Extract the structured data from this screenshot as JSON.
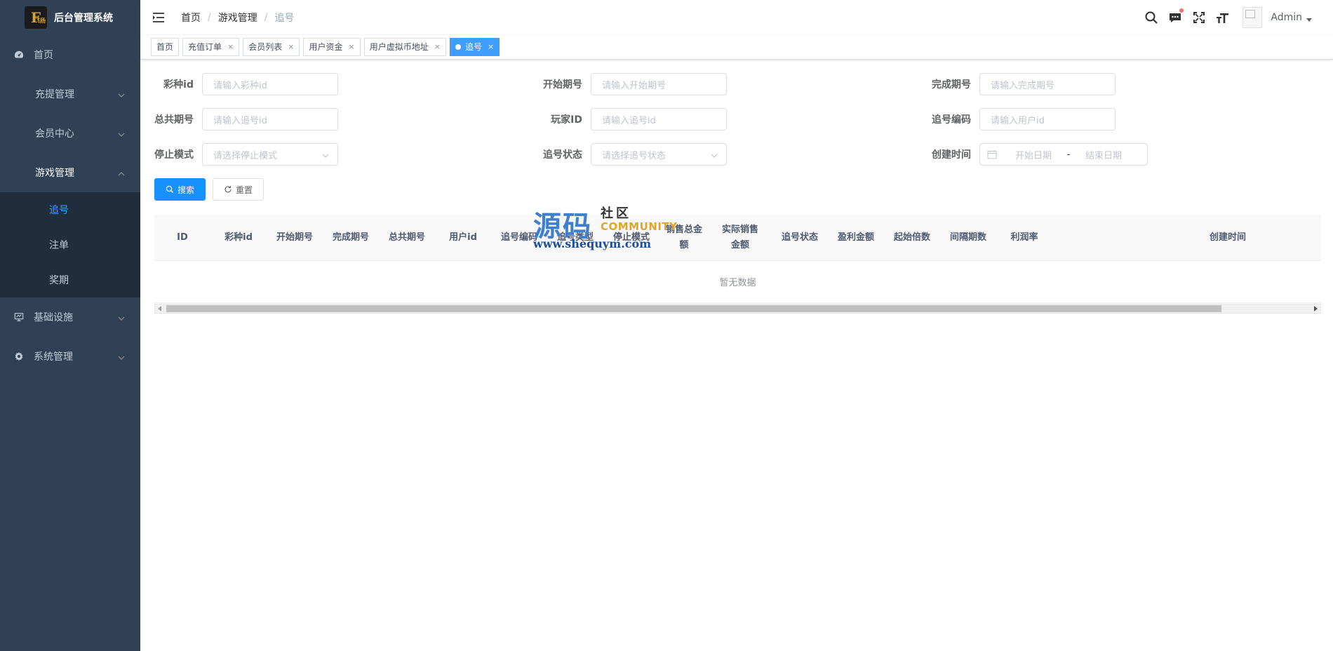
{
  "app": {
    "logo_mark": "F",
    "logo_sub": "飞扬",
    "title": "后台管理系统"
  },
  "sidebar": {
    "items": [
      {
        "label": "首页"
      },
      {
        "label": "充提管理"
      },
      {
        "label": "会员中心"
      },
      {
        "label": "游戏管理"
      },
      {
        "label": "基础设施"
      },
      {
        "label": "系统管理"
      }
    ],
    "game_sub": [
      {
        "label": "追号"
      },
      {
        "label": "注单"
      },
      {
        "label": "奖期"
      }
    ]
  },
  "breadcrumb": {
    "home": "首页",
    "sep": "/",
    "parent": "游戏管理",
    "current": "追号"
  },
  "navbar": {
    "username": "Admin"
  },
  "tags": [
    {
      "label": "首页"
    },
    {
      "label": "充值订单",
      "close": "×"
    },
    {
      "label": "会员列表",
      "close": "×"
    },
    {
      "label": "用户资金",
      "close": "×"
    },
    {
      "label": "用户虚拟币地址",
      "close": "×"
    },
    {
      "label": "追号",
      "close": "×"
    }
  ],
  "filters": {
    "lottery_id": {
      "label": "彩种id",
      "placeholder": "请输入彩种id"
    },
    "start_issue": {
      "label": "开始期号",
      "placeholder": "请输入开始期号"
    },
    "end_issue": {
      "label": "完成期号",
      "placeholder": "请输入完成期号"
    },
    "total_issue": {
      "label": "总共期号",
      "placeholder": "请输入追号id"
    },
    "player_id": {
      "label": "玩家ID",
      "placeholder": "请输入追号id"
    },
    "chase_code": {
      "label": "追号编码",
      "placeholder": "请输入用户id"
    },
    "stop_mode": {
      "label": "停止模式",
      "placeholder": "请选择停止模式"
    },
    "chase_status": {
      "label": "追号状态",
      "placeholder": "请选择追号状态"
    },
    "created_time": {
      "label": "创建时间",
      "start": "开始日期",
      "sep": "-",
      "end": "结束日期"
    }
  },
  "buttons": {
    "search": "搜索",
    "reset": "重置"
  },
  "table": {
    "columns": [
      "ID",
      "彩种id",
      "开始期号",
      "完成期号",
      "总共期号",
      "用户id",
      "追号编码",
      "追号类型",
      "停止模式",
      "销售总金额",
      "实际销售金额",
      "追号状态",
      "盈利金额",
      "起始倍数",
      "间隔期数",
      "利润率",
      "创建时间"
    ],
    "empty_text": "暂无数据"
  },
  "watermark": {
    "big": "源码",
    "small": "社区",
    "community": "COMMUNITY",
    "url": "www.shequym.com"
  },
  "colors": {
    "sidebar_bg": "#304156",
    "submenu_bg": "#1f2d3d",
    "accent": "#409eff",
    "primary_button": "#1890ff"
  }
}
